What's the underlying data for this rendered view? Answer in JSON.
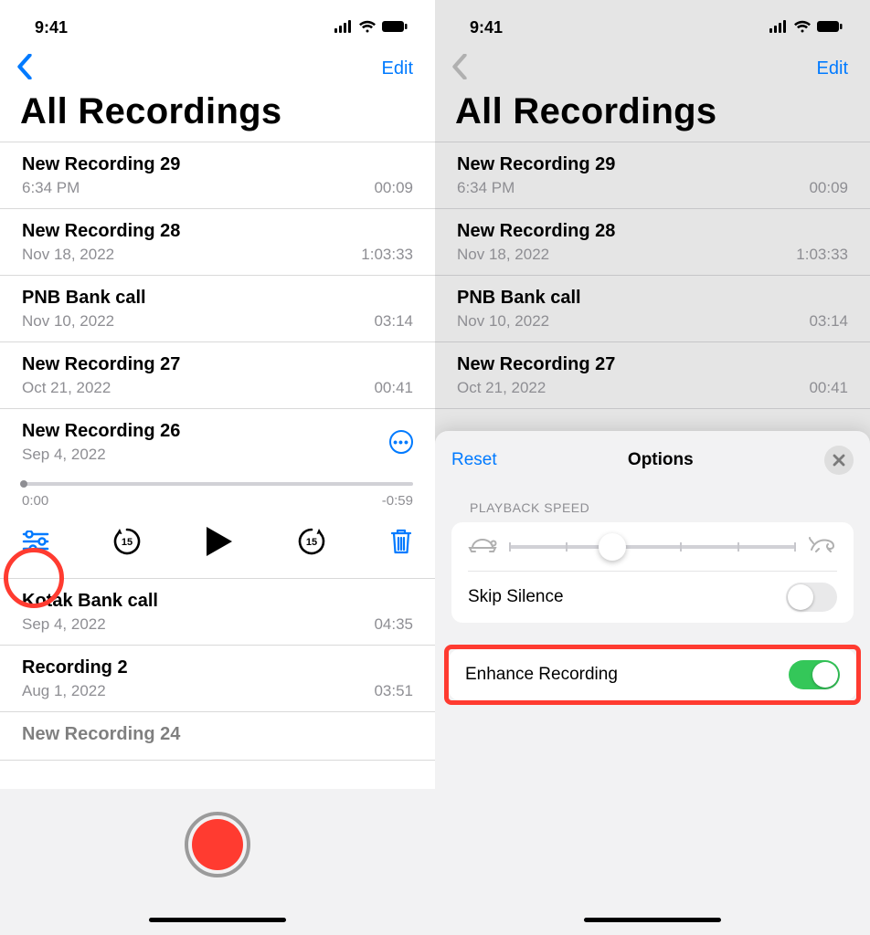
{
  "status": {
    "time": "9:41"
  },
  "nav": {
    "edit": "Edit"
  },
  "title": "All Recordings",
  "recordings": [
    {
      "title": "New Recording 29",
      "sub": "6:34 PM",
      "dur": "00:09"
    },
    {
      "title": "New Recording 28",
      "sub": "Nov 18, 2022",
      "dur": "1:03:33"
    },
    {
      "title": "PNB Bank call",
      "sub": "Nov 10, 2022",
      "dur": "03:14"
    },
    {
      "title": "New Recording 27",
      "sub": "Oct 21, 2022",
      "dur": "00:41"
    },
    {
      "title": "New Recording 26",
      "sub": "Sep 4, 2022",
      "dur": "",
      "elapsed": "0:00",
      "remaining": "-0:59"
    },
    {
      "title": "Kotak Bank call",
      "sub": "Sep 4, 2022",
      "dur": "04:35"
    },
    {
      "title": "Recording 2",
      "sub": "Aug 1, 2022",
      "dur": "03:51"
    },
    {
      "title": "New Recording 24",
      "sub": "",
      "dur": ""
    }
  ],
  "options": {
    "reset": "Reset",
    "title": "Options",
    "speed_label": "PLAYBACK SPEED",
    "skip_silence": "Skip Silence",
    "enhance": "Enhance Recording",
    "skip_silence_on": false,
    "enhance_on": true
  },
  "colors": {
    "accent": "#007aff",
    "record": "#ff3b30",
    "green": "#34c759",
    "highlight": "#ff3b30"
  }
}
